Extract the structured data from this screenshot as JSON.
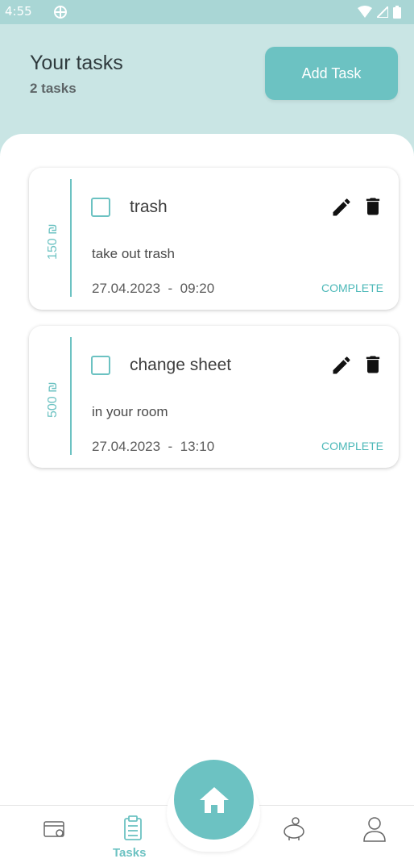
{
  "status_bar": {
    "time": "4:55"
  },
  "header": {
    "title": "Your tasks",
    "count": "2  tasks",
    "add_button": "Add Task"
  },
  "tasks": [
    {
      "price": "150 ₪",
      "title": "trash",
      "description": "take out trash",
      "datetime": "27.04.2023  -  09:20",
      "action": "COMPLETE"
    },
    {
      "price": "500 ₪",
      "title": "change sheet",
      "description": "in your room",
      "datetime": "27.04.2023  -  13:10",
      "action": "COMPLETE"
    }
  ],
  "nav": {
    "tasks_label": "Tasks"
  },
  "colors": {
    "accent": "#6cc2c2",
    "header_bg": "#c9e5e4",
    "status_bg": "#a9d6d5"
  }
}
